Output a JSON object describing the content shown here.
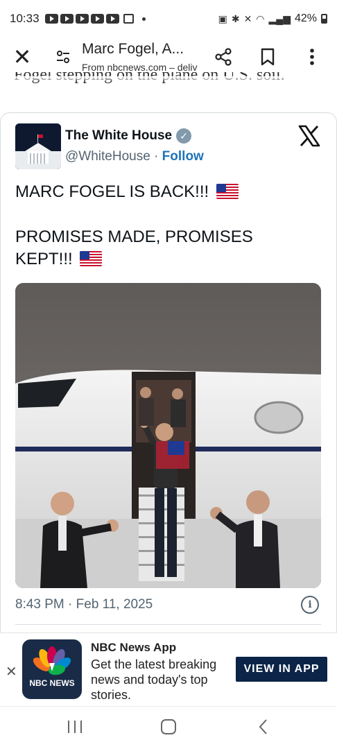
{
  "status_bar": {
    "time": "10:33",
    "battery": "42%"
  },
  "browser": {
    "page_title": "Marc Fogel, A...",
    "source_url": "From nbcnews.com – deliv",
    "icons": [
      "close-icon",
      "tune-icon",
      "share-icon",
      "bookmark-icon",
      "more-vert-icon"
    ]
  },
  "article": {
    "cut_text": "Fogel stepping on the plane on U.S. soil."
  },
  "tweet": {
    "author_name": "The White House",
    "handle": "@WhiteHouse",
    "separator": "·",
    "follow_label": "Follow",
    "line1": "MARC FOGEL IS BACK!!!",
    "line2": "PROMISES MADE, PROMISES",
    "line3": "KEPT!!!",
    "timestamp": "8:43 PM · Feb 11, 2025",
    "info_glyph": "i"
  },
  "ad": {
    "logo_text": "NBC NEWS",
    "title": "NBC News App",
    "description": "Get the latest breaking news and today's top stories.",
    "cta_label": "VIEW IN APP",
    "close_glyph": "✕"
  },
  "colors": {
    "follow_blue": "#1d74b9",
    "cta_navy": "#0b2447",
    "verified_gray": "#829aab"
  }
}
